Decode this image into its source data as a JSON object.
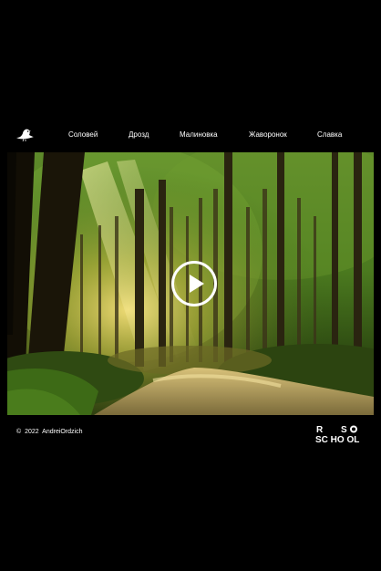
{
  "header": {
    "logo_icon": "bird-icon",
    "nav": [
      {
        "label": "Соловей"
      },
      {
        "label": "Дрозд"
      },
      {
        "label": "Малиновка"
      },
      {
        "label": "Жаворонок"
      },
      {
        "label": "Славка"
      }
    ]
  },
  "player": {
    "scene": "forest-road-sunbeams",
    "play_icon": "play-icon"
  },
  "footer": {
    "copyright_symbol": "©",
    "year": "2022",
    "author": "AndreiOrdzich",
    "school_logo_icon": "rs-school-logo"
  },
  "colors": {
    "background": "#000000",
    "text": "#ffffff",
    "accent": "#ffffff"
  }
}
